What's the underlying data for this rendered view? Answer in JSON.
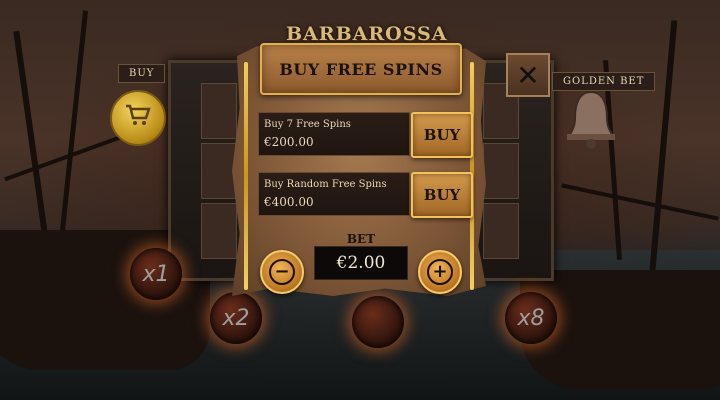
{
  "game": {
    "logo_text": "BARBAROSSA"
  },
  "side": {
    "buy_label": "BUY",
    "golden_bet_label": "GOLDEN BET"
  },
  "multipliers": [
    "x1",
    "x2",
    "x8"
  ],
  "dialog": {
    "title": "BUY FREE SPINS",
    "close_symbol": "✕",
    "options": [
      {
        "label": "Buy 7 Free Spins",
        "price": "€200.00",
        "button": "BUY"
      },
      {
        "label": "Buy Random Free Spins",
        "price": "€400.00",
        "button": "BUY"
      }
    ],
    "bet": {
      "label": "BET",
      "value": "€2.00",
      "decrease_symbol": "−",
      "increase_symbol": "+"
    }
  }
}
